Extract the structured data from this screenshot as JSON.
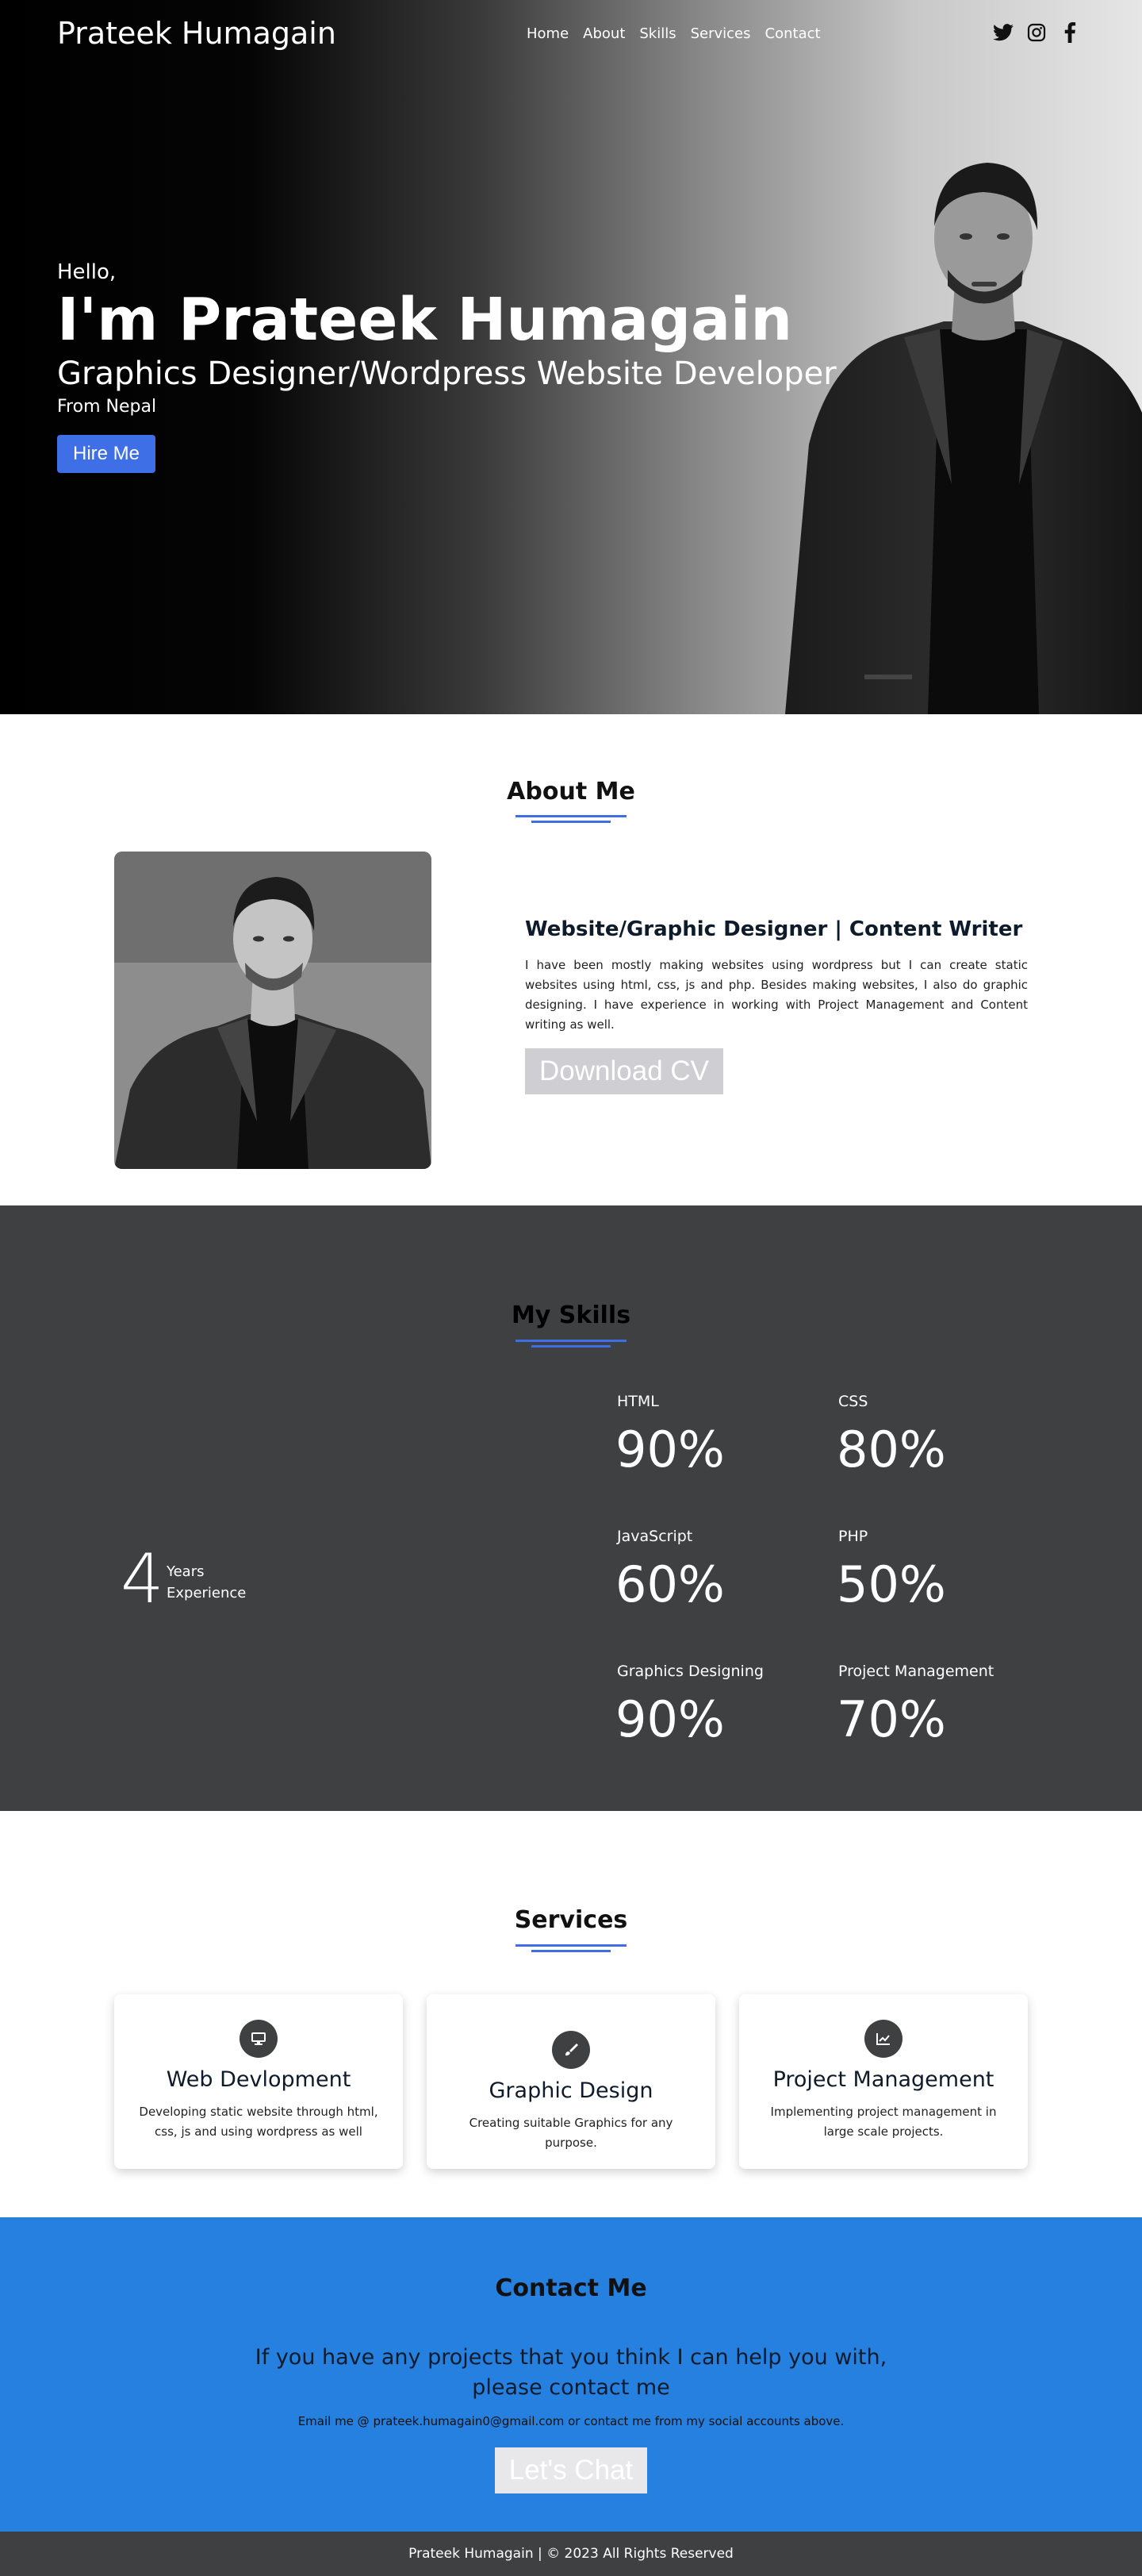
{
  "header": {
    "brand": "Prateek Humagain",
    "nav": [
      "Home",
      "About",
      "Skills",
      "Services",
      "Contact"
    ],
    "socials": [
      "twitter-icon",
      "instagram-icon",
      "facebook-icon"
    ]
  },
  "hero": {
    "greeting": "Hello,",
    "name": "I'm Prateek Humagain",
    "role": "Graphics Designer/Wordpress Website Developer",
    "from": "From Nepal",
    "cta": "Hire Me"
  },
  "about": {
    "title": "About Me",
    "heading": "Website/Graphic Designer | Content Writer",
    "text": "I have been mostly making websites using wordpress but I can create static websites using html, css, js and php. Besides making websites, I also do graphic designing. I have experience in working with Project Management and Content writing as well.",
    "cta": "Download CV"
  },
  "skills": {
    "title": "My Skills",
    "years_number": "4",
    "years_line1": "Years",
    "years_line2": "Experience",
    "items": [
      {
        "name": "HTML",
        "value": "90%"
      },
      {
        "name": "CSS",
        "value": "80%"
      },
      {
        "name": "JavaScript",
        "value": "60%"
      },
      {
        "name": "PHP",
        "value": "50%"
      },
      {
        "name": "Graphics Designing",
        "value": "90%"
      },
      {
        "name": "Project Management",
        "value": "70%"
      }
    ]
  },
  "services": {
    "title": "Services",
    "items": [
      {
        "icon": "monitor-icon",
        "title": "Web Devlopment",
        "desc": "Developing static website through html, css, js and using wordpress as well"
      },
      {
        "icon": "brush-icon",
        "title": "Graphic Design",
        "desc": "Creating suitable Graphics for any purpose."
      },
      {
        "icon": "chart-icon",
        "title": "Project Management",
        "desc": "Implementing project management in large scale projects."
      }
    ]
  },
  "contact": {
    "title": "Contact Me",
    "lead": "If you have any projects that you think I can help you with, please contact me",
    "email_line": "Email me @ prateek.humagain0@gmail.com or contact me from my social accounts above.",
    "cta": "Let's Chat"
  },
  "footer": {
    "name": "Prateek Humagain",
    "rights": " | © 2023 All Rights Reserved"
  },
  "colors": {
    "accent": "#3f6fe6",
    "dark": "#3f4042",
    "contact_bg": "#2580e0"
  }
}
